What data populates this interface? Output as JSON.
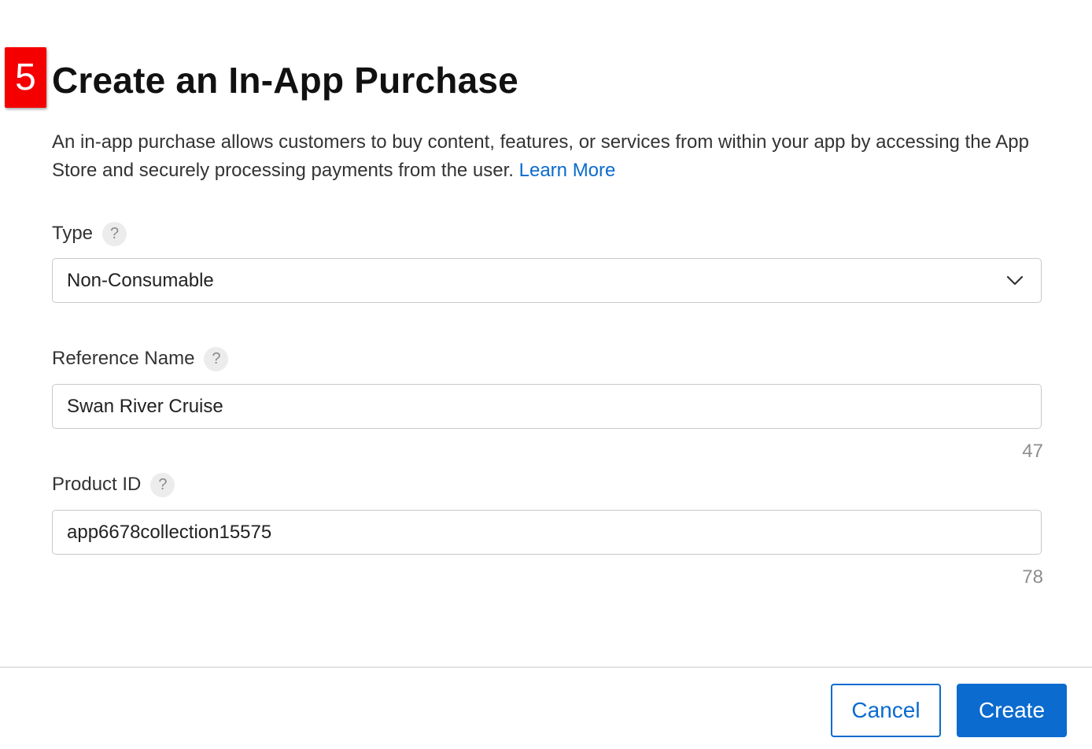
{
  "step_badge": "5",
  "dialog": {
    "title": "Create an In-App Purchase",
    "description": "An in-app purchase allows customers to buy content, features, or services from within your app by accessing the App Store and securely processing payments from the user.",
    "learn_more": "Learn More"
  },
  "fields": {
    "type": {
      "label": "Type",
      "value": "Non-Consumable"
    },
    "reference_name": {
      "label": "Reference Name",
      "value": "Swan River Cruise",
      "remaining": "47"
    },
    "product_id": {
      "label": "Product ID",
      "value": "app6678collection15575",
      "remaining": "78"
    },
    "help_glyph": "?"
  },
  "footer": {
    "cancel_label": "Cancel",
    "create_label": "Create"
  },
  "colors": {
    "accent": "#0b6bce",
    "badge": "#f50000"
  },
  "icons": {
    "help": "question-circle-icon",
    "dropdown": "chevron-down-icon"
  }
}
